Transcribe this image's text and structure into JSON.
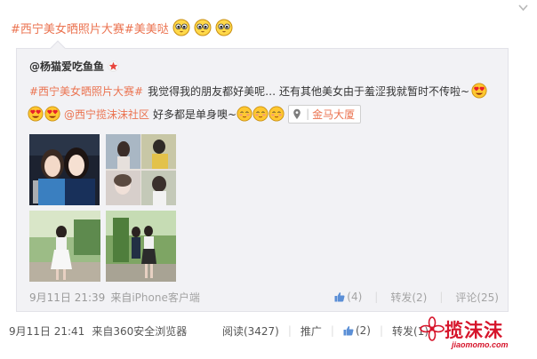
{
  "post": {
    "topic": "#西宁美女晒照片大赛#",
    "text": "美美哒",
    "emojis": [
      "cute-face-icon",
      "cute-face-icon",
      "cute-face-icon"
    ]
  },
  "quoted": {
    "author": "@杨猫爱吃鱼鱼",
    "topic": "#西宁美女晒照片大赛#",
    "text1": "我觉得我的朋友都好美呢… 还有其他美女由于羞涩我就暂时不传啦~",
    "mention": "@西宁揽沫沫社区",
    "text2": "好多都是单身噢~",
    "location": "金马大厦",
    "time": "9月11日 21:39",
    "source_prefix": "来自",
    "source": "iPhone客户端",
    "actions": {
      "like": "(4)",
      "forward": "转发(2)",
      "comment": "评论(25)"
    }
  },
  "footer": {
    "time": "9月11日 21:41",
    "source": "来自360安全浏览器",
    "read": "阅读(3427)",
    "promote": "推广",
    "like": "(2)",
    "forward": "转发(1)"
  },
  "watermark": {
    "name": "揽沫沫",
    "url": "jiaomomo.com"
  },
  "colors": {
    "topic": "#eb7350",
    "quote_bg": "#f2f2f5",
    "watermark": "#d6152b"
  }
}
